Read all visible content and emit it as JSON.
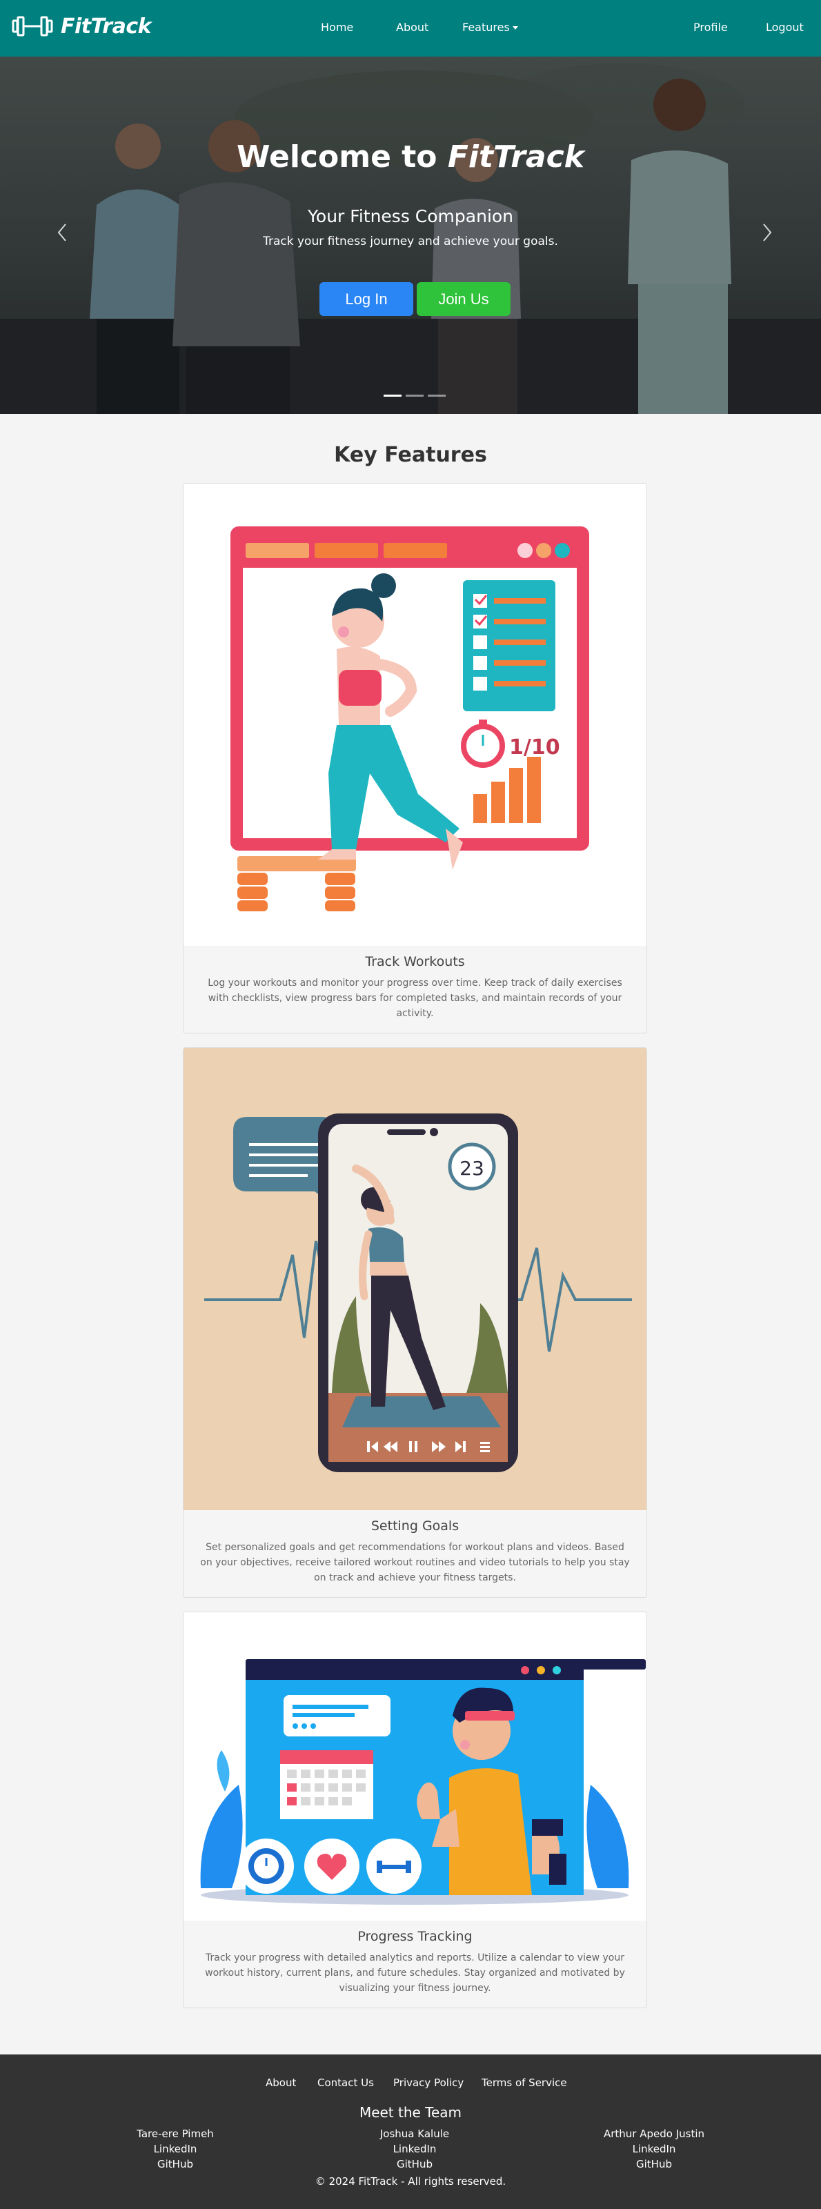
{
  "nav": {
    "brand": "FitTrack",
    "links": {
      "home": "Home",
      "about": "About",
      "features": "Features",
      "profile": "Profile",
      "logout": "Logout"
    }
  },
  "hero": {
    "title_prefix": "Welcome to",
    "title_brand": "FitTrack",
    "subtitle": "Your Fitness Companion",
    "tagline": "Track your fitness journey and achieve your goals.",
    "login_label": "Log In",
    "join_label": "Join Us"
  },
  "features": {
    "title": "Key Features",
    "cards": [
      {
        "title": "Track Workouts",
        "text_lines": [
          "Log your workouts and monitor your progress over time. Keep track of daily exercises",
          "with checklists, view progress bars for completed tasks, and maintain records of your",
          "activity."
        ],
        "counter": "1/10"
      },
      {
        "title": "Setting Goals",
        "text_lines": [
          "Set personalized goals and get recommendations for workout plans and videos. Based",
          "on your objectives, receive tailored workout routines and video tutorials to help you stay",
          "on track and achieve your fitness targets."
        ],
        "timer": "23"
      },
      {
        "title": "Progress Tracking",
        "text_lines": [
          "Track your progress with detailed analytics and reports. Utilize a calendar to view your",
          "workout history, current plans, and future schedules. Stay organized and motivated by",
          "visualizing your fitness journey."
        ]
      }
    ]
  },
  "footer": {
    "links": {
      "about": "About",
      "contact": "Contact Us",
      "privacy": "Privacy Policy",
      "terms": "Terms of Service"
    },
    "team_title": "Meet the Team",
    "team": [
      {
        "name": "Tare-ere Pimeh",
        "linkedin": "LinkedIn",
        "github": "GitHub"
      },
      {
        "name": "Joshua Kalule",
        "linkedin": "LinkedIn",
        "github": "GitHub"
      },
      {
        "name": "Arthur Apedo Justin",
        "linkedin": "LinkedIn",
        "github": "GitHub"
      }
    ],
    "copyright": "© 2024 FitTrack - All rights reserved."
  },
  "colors": {
    "nav": "#00807f",
    "login": "#2a86f5",
    "join": "#2fc23b",
    "footer": "#333333"
  }
}
